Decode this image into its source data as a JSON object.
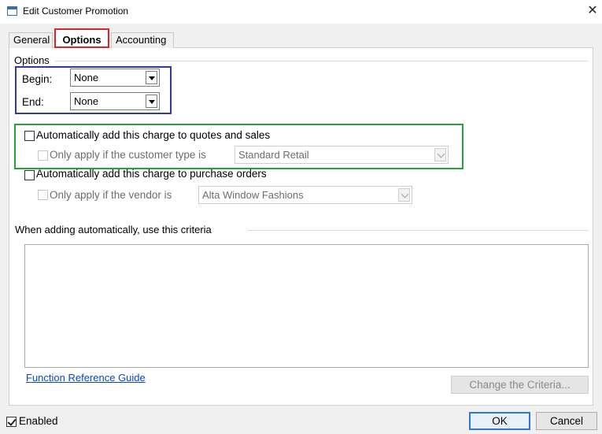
{
  "window": {
    "title": "Edit Customer Promotion",
    "close_glyph": "✕"
  },
  "tabs": [
    {
      "label": "General"
    },
    {
      "label": "Options"
    },
    {
      "label": "Accounting"
    }
  ],
  "options_group": {
    "title": "Options",
    "begin": {
      "label": "Begin:",
      "value": "None"
    },
    "end": {
      "label": "End:",
      "value": "None"
    }
  },
  "quotes": {
    "label": "Automatically add this charge to quotes and sales",
    "checked": false,
    "sub_label": "Only apply if the customer type is",
    "sub_value": "Standard Retail"
  },
  "purchase": {
    "label": "Automatically add this charge to purchase orders",
    "checked": false,
    "sub_label": "Only apply if the vendor is",
    "sub_value": "Alta Window Fashions"
  },
  "criteria": {
    "title": "When adding automatically, use this criteria",
    "value": ""
  },
  "links": {
    "function_reference": "Function Reference Guide"
  },
  "buttons": {
    "change_criteria": "Change the Criteria...",
    "ok": "OK",
    "cancel": "Cancel"
  },
  "footer": {
    "enabled_label": "Enabled",
    "enabled_checked": true
  },
  "colors": {
    "highlight_red": "#d9262a",
    "highlight_blue": "#2f3aa6",
    "highlight_green": "#25a33a",
    "link": "#0645d8",
    "accent": "#2f78d2"
  }
}
